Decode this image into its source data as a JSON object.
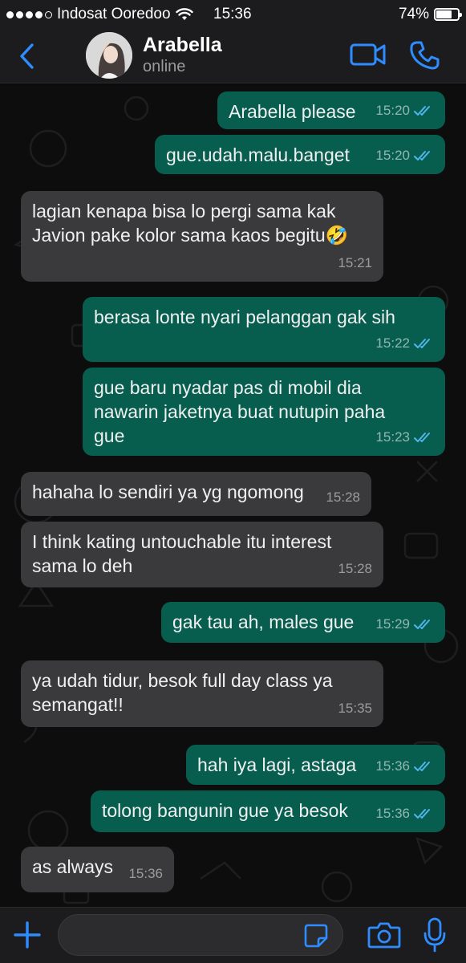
{
  "status_bar": {
    "carrier": "Indosat Ooredoo",
    "time": "15:36",
    "battery": "74%",
    "battery_level": 0.74
  },
  "header": {
    "contact_name": "Arabella",
    "contact_status": "online"
  },
  "messages": [
    {
      "direction": "out",
      "text": "Arabella please",
      "time": "15:20"
    },
    {
      "direction": "out",
      "text": "gue.udah.malu.banget",
      "time": "15:20"
    },
    {
      "direction": "in",
      "text": "lagian kenapa bisa lo pergi sama kak\nJavion pake kolor sama kaos begitu🤣",
      "time": "15:21"
    },
    {
      "direction": "out",
      "text": "berasa lonte nyari pelanggan gak sih",
      "time": "15:22"
    },
    {
      "direction": "out",
      "text": "gue baru nyadar pas di mobil dia\nnawarin jaketnya buat nutupin paha\ngue",
      "time": "15:23"
    },
    {
      "direction": "in",
      "text": "hahaha lo sendiri ya yg ngomong",
      "time": "15:28"
    },
    {
      "direction": "in",
      "text": "I think kating untouchable itu interest\nsama lo deh",
      "time": "15:28"
    },
    {
      "direction": "out",
      "text": "gak tau ah, males gue",
      "time": "15:29"
    },
    {
      "direction": "in",
      "text": "ya udah tidur, besok full day class ya\nsemangat!!",
      "time": "15:35"
    },
    {
      "direction": "out",
      "text": "hah iya lagi, astaga",
      "time": "15:36"
    },
    {
      "direction": "out",
      "text": "tolong bangunin gue ya besok",
      "time": "15:36"
    },
    {
      "direction": "in",
      "text": "as always",
      "time": "15:36"
    }
  ],
  "input": {
    "placeholder": ""
  },
  "colors": {
    "accent": "#2f8cff",
    "outgoing_bubble": "#075e4f",
    "incoming_bubble": "#3a3a3c",
    "read_ticks": "#4fb6ec"
  }
}
